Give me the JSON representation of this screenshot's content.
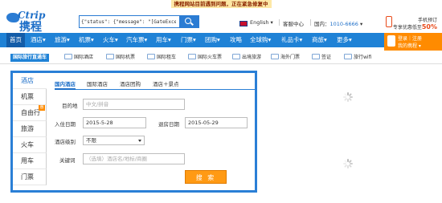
{
  "notice": "携程网站目前遇到问题，正在紧急修复中",
  "logo": {
    "en": "Ctrip",
    "cn": "携程"
  },
  "search": {
    "value": "{\"status\": {\"message\": \"[GateException]Filter thre",
    "placeholder": ""
  },
  "header": {
    "language": "English ▾",
    "service": "客服中心",
    "phone_prefix": "国内：",
    "phone_number": "1010-6666",
    "promo_line1": "手机预订",
    "promo_line2_prefix": "专享优惠低至",
    "promo_line2_value": "50%"
  },
  "nav": {
    "items": [
      "首页",
      "酒店▾",
      "旅游▾",
      "机票▾",
      "火车▾",
      "汽车票▾",
      "用车▾",
      "门票▾",
      "团购▾",
      "攻略",
      "全球购▾",
      "礼品卡▾",
      "商旅▾",
      "更多▾"
    ],
    "user_line1": "登录｜注册",
    "user_line2": "我的携程 ▾"
  },
  "subnav": {
    "title": "国际旅行直通车",
    "items": [
      "国际酒店",
      "国际机票",
      "国际租车",
      "国际火车票",
      "出境旅游",
      "海外门票",
      "签证",
      "旅行wifi"
    ]
  },
  "panel": {
    "vtabs": [
      "酒店",
      "机票",
      "自由行",
      "旅游",
      "火车",
      "用车",
      "门票"
    ],
    "vtab_badge": "惠",
    "htabs": [
      "国内酒店",
      "国际酒店",
      "酒店团购",
      "酒店＋景点"
    ],
    "destination_label": "目的地",
    "destination_placeholder": "中文/拼音",
    "checkin_label": "入住日期",
    "checkin_value": "2015-5-28",
    "checkout_label": "退房日期",
    "checkout_value": "2015-05-29",
    "level_label": "酒店级别",
    "level_value": "不限",
    "keyword_label": "关键词",
    "keyword_placeholder": "（选填）酒店名/地标/商圈",
    "search_button": "搜 索"
  },
  "colors": {
    "nav": "#1f82d6",
    "accent": "#ff9a14",
    "panel_border": "#2a7fd6"
  }
}
